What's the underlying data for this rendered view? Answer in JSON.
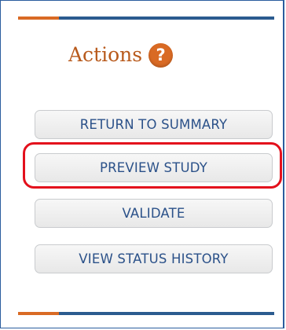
{
  "actions": {
    "heading": "Actions",
    "help_icon_glyph": "?",
    "buttons": [
      {
        "label": "RETURN TO SUMMARY"
      },
      {
        "label": "PREVIEW STUDY"
      },
      {
        "label": "VALIDATE"
      },
      {
        "label": "VIEW STATUS HISTORY"
      }
    ]
  },
  "colors": {
    "heading": "#b85a1c",
    "accent_orange": "#d96a24",
    "rule_blue": "#2b5b8f",
    "button_text": "#2b5189",
    "highlight": "#e3101c"
  },
  "icons": [
    "help-icon"
  ]
}
